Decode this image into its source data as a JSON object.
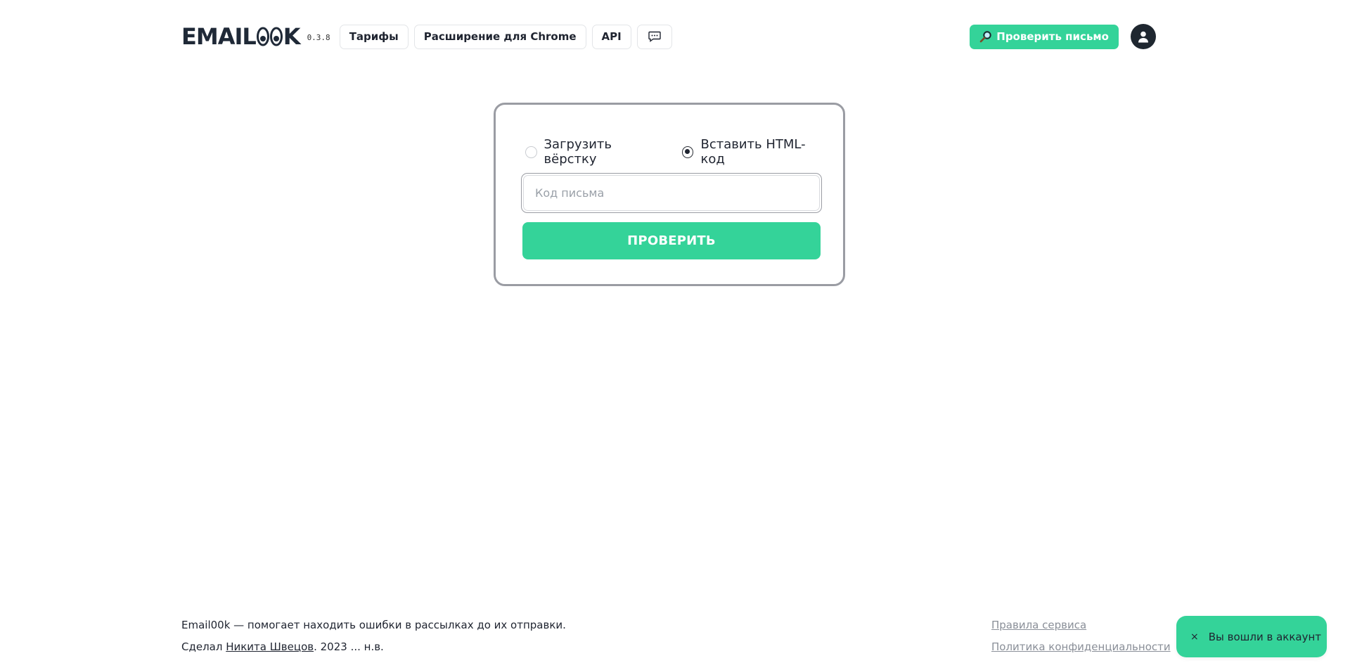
{
  "header": {
    "logo_start": "EMAIL",
    "logo_end": "K",
    "version": "0.3.8",
    "nav": [
      {
        "label": "Тарифы"
      },
      {
        "label": "Расширение для Chrome"
      },
      {
        "label": "API"
      }
    ],
    "chat_icon": "chat-bubble-icon",
    "check_button_label": "Проверить письмо",
    "check_button_icon": "magnifier-icon",
    "avatar_icon": "user-icon"
  },
  "form": {
    "options": [
      {
        "label": "Загрузить вёрстку",
        "checked": false
      },
      {
        "label": "Вставить HTML-код",
        "checked": true
      }
    ],
    "code_input": {
      "value": "",
      "placeholder": "Код письма"
    },
    "submit_label": "ПРОВЕРИТЬ"
  },
  "footer": {
    "tagline": "Email00k — помогает находить ошибки в рассылках до их отправки.",
    "made_by_prefix": "Сделал ",
    "author": "Никита Швецов",
    "made_by_suffix": ". 2023 ... н.в.",
    "links": [
      {
        "label": "Правила сервиса"
      },
      {
        "label": "Политика конфиденциальности"
      }
    ]
  },
  "toast": {
    "close": "×",
    "message": "Вы вошли в аккаунт"
  },
  "colors": {
    "accent": "#34d399",
    "dark": "#1f2730",
    "border": "#9a9ca3"
  }
}
